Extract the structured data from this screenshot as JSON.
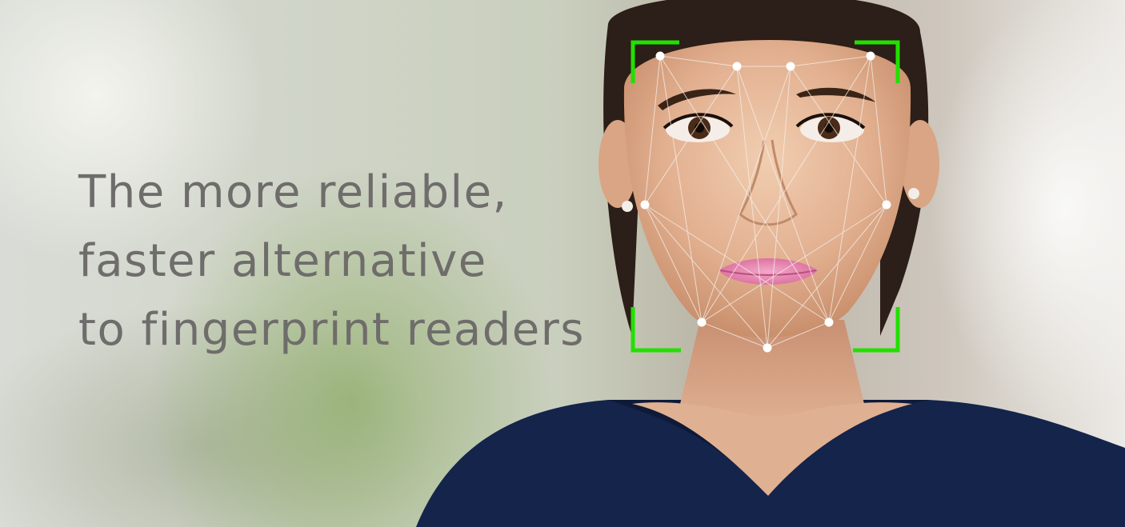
{
  "headline": {
    "line1": "The more reliable,",
    "line2": "faster alternative",
    "line3": "to fingerprint readers"
  },
  "colors": {
    "headline_text": "#6f6d6b",
    "frame_corner": "#22e000",
    "landmark_dot": "#ffffff",
    "mesh_line": "#f4f1ec",
    "top": "#14244a"
  },
  "icons": {
    "frame": "face-detection-frame-icon",
    "landmark": "facial-landmark-dot-icon"
  }
}
